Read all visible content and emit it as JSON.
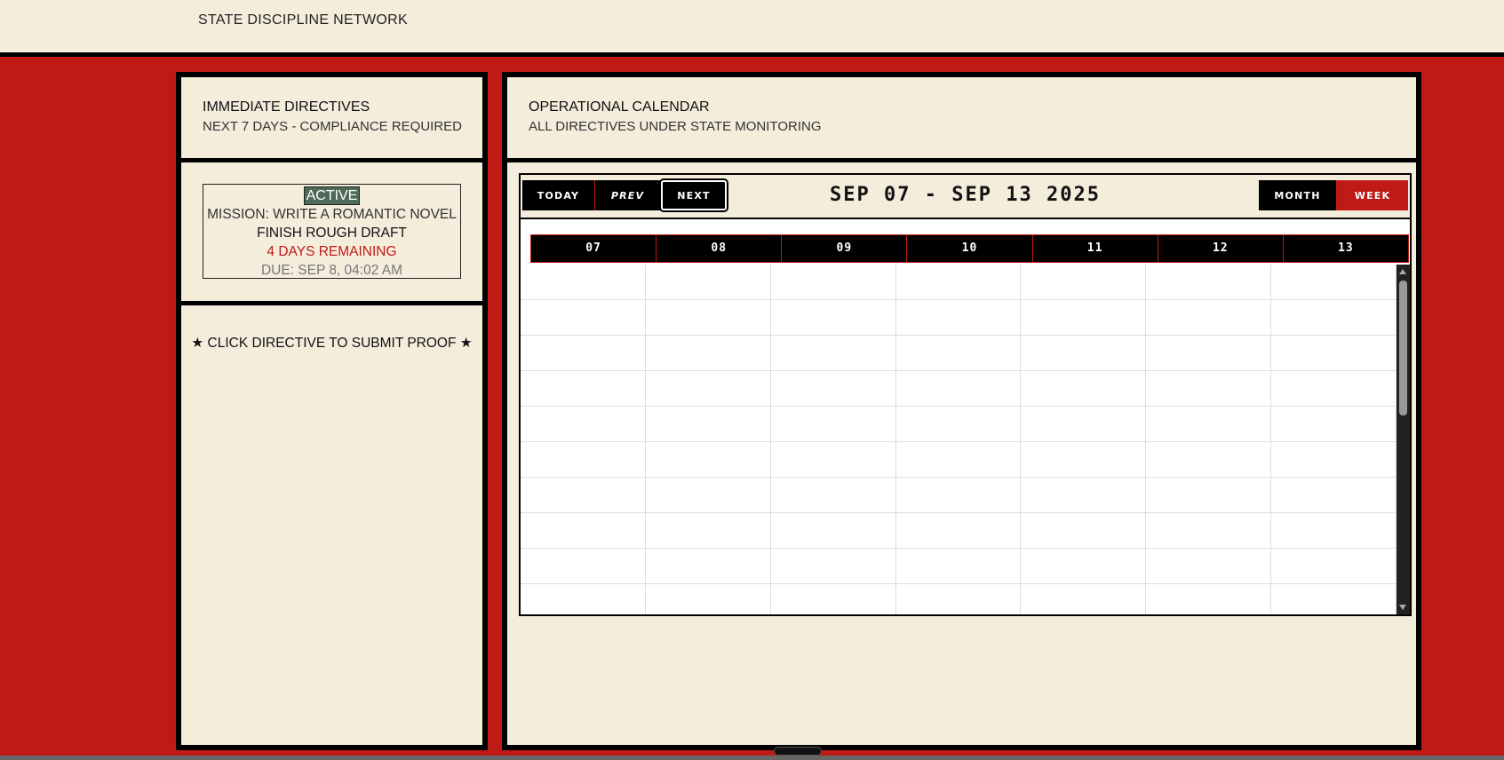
{
  "header": {
    "brand": "STATE DISCIPLINE NETWORK"
  },
  "left": {
    "title": "IMMEDIATE DIRECTIVES",
    "subtitle": "NEXT 7 DAYS - COMPLIANCE REQUIRED",
    "directive": {
      "badge": "ACTIVE",
      "mission": "MISSION: WRITE A ROMANTIC NOVEL",
      "title": "FINISH ROUGH DRAFT",
      "remaining": "4 DAYS REMAINING",
      "due": "DUE: SEP 8, 04:02 AM"
    },
    "hint": "★ CLICK DIRECTIVE TO SUBMIT PROOF ★"
  },
  "right": {
    "title": "OPERATIONAL CALENDAR",
    "subtitle": "ALL DIRECTIVES UNDER STATE MONITORING",
    "calendar": {
      "range": "SEP 07 - SEP 13 2025",
      "buttons": {
        "today": "TODAY",
        "prev": "PREV",
        "next": "NEXT",
        "month": "MONTH",
        "week": "WEEK"
      },
      "active_view": "WEEK",
      "days": [
        "07",
        "08",
        "09",
        "10",
        "11",
        "12",
        "13"
      ]
    }
  },
  "colors": {
    "accent_red": "#c01a17",
    "paper": "#f5eddc",
    "badge_green": "#4d6b58"
  }
}
